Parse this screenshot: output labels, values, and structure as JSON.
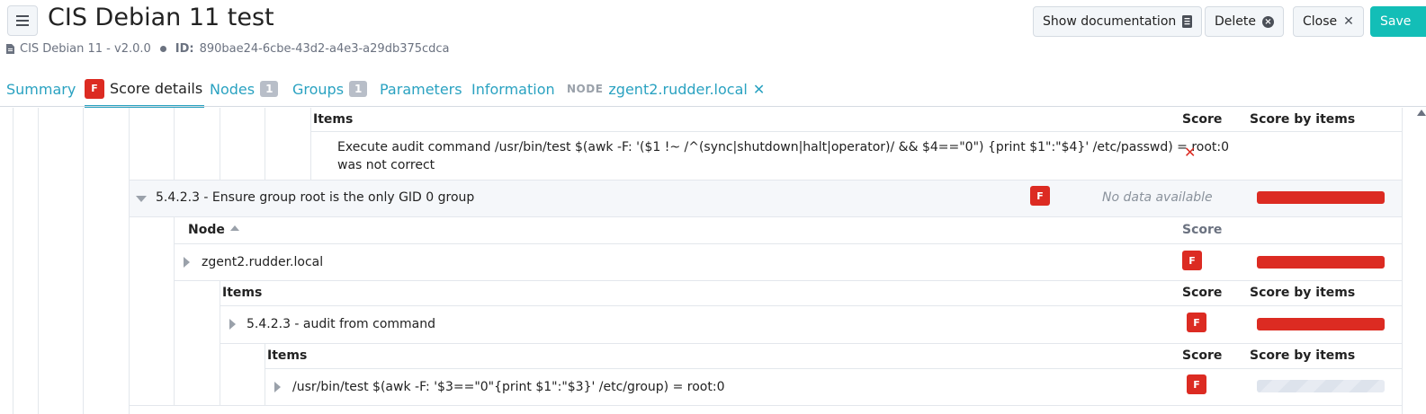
{
  "header": {
    "title": "CIS Debian 11 test",
    "source": "CIS Debian 11 - v2.0.0",
    "id_label": "ID:",
    "id_value": "890bae24-6cbe-43d2-a4e3-a29db375cdca",
    "buttons": {
      "show_documentation": "Show documentation",
      "delete": "Delete",
      "close": "Close",
      "save": "Save"
    }
  },
  "tabs": {
    "summary": "Summary",
    "score_badge": "F",
    "score_details": "Score details",
    "nodes": "Nodes",
    "nodes_count": "1",
    "groups": "Groups",
    "groups_count": "1",
    "parameters": "Parameters",
    "information": "Information",
    "node_label": "NODE",
    "node_name": "zgent2.rudder.local",
    "node_close": "✕"
  },
  "table": {
    "top_items_header": "Items",
    "score_header": "Score",
    "score_by_items_header": "Score by items",
    "top_item_line1": "Execute audit command /usr/bin/test $(awk -F: '($1 !~ /^(sync|shutdown|halt|operator)/ && $4==\"0\") {print $1\":\"$4}' /etc/passwd) = root:0",
    "top_item_line2": "was not correct",
    "rule": {
      "label": "5.4.2.3 - Ensure group root is the only GID 0 group",
      "score": "F",
      "no_data": "No data available"
    },
    "node_header": "Node",
    "node_score_header": "Score",
    "node_row": {
      "name": "zgent2.rudder.local",
      "score": "F"
    },
    "items_header": "Items",
    "items_score_header": "Score",
    "items_score_by_items_header": "Score by items",
    "item_row": {
      "label": "5.4.2.3 - audit from command",
      "score": "F"
    },
    "sub_items_header": "Items",
    "sub_score_header": "Score",
    "sub_score_by_items_header": "Score by items",
    "sub_item_row": {
      "label": "/usr/bin/test $(awk -F: '$3==\"0\"{print $1\":\"$3}' /etc/group) = root:0",
      "score": "F"
    }
  },
  "colors": {
    "accent": "#2aa2c1",
    "save": "#13beb7",
    "fail": "#dc2b22"
  }
}
